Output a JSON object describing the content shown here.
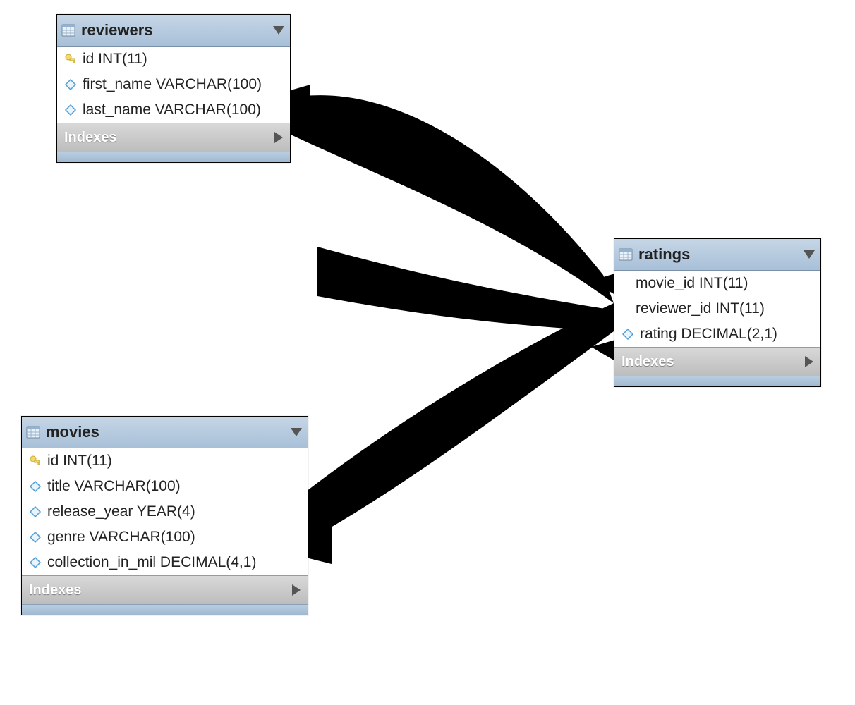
{
  "diagram": {
    "tables": {
      "reviewers": {
        "title": "reviewers",
        "indexes_label": "Indexes",
        "columns": [
          {
            "icon": "key",
            "label": "id INT(11)"
          },
          {
            "icon": "diamond",
            "label": "first_name VARCHAR(100)"
          },
          {
            "icon": "diamond",
            "label": "last_name VARCHAR(100)"
          }
        ]
      },
      "movies": {
        "title": "movies",
        "indexes_label": "Indexes",
        "columns": [
          {
            "icon": "key",
            "label": "id INT(11)"
          },
          {
            "icon": "diamond",
            "label": "title VARCHAR(100)"
          },
          {
            "icon": "diamond",
            "label": "release_year YEAR(4)"
          },
          {
            "icon": "diamond",
            "label": "genre VARCHAR(100)"
          },
          {
            "icon": "diamond",
            "label": "collection_in_mil DECIMAL(4,1)"
          }
        ]
      },
      "ratings": {
        "title": "ratings",
        "indexes_label": "Indexes",
        "columns": [
          {
            "icon": "none",
            "label": "movie_id INT(11)"
          },
          {
            "icon": "none",
            "label": "reviewer_id INT(11)"
          },
          {
            "icon": "diamond",
            "label": "rating DECIMAL(2,1)"
          }
        ]
      }
    },
    "relationships": [
      {
        "from": "reviewers",
        "to": "ratings"
      },
      {
        "from": "movies",
        "to": "ratings"
      }
    ]
  },
  "colors": {
    "header_gradient_top": "#c6d6e6",
    "header_gradient_bottom": "#a8c0d8",
    "indexes_gradient_top": "#d8d8d8",
    "indexes_gradient_bottom": "#bdbdbd",
    "key_icon": "#e6c84a",
    "diamond_stroke": "#4f9ed8",
    "diamond_fill": "#eaf4fc"
  }
}
